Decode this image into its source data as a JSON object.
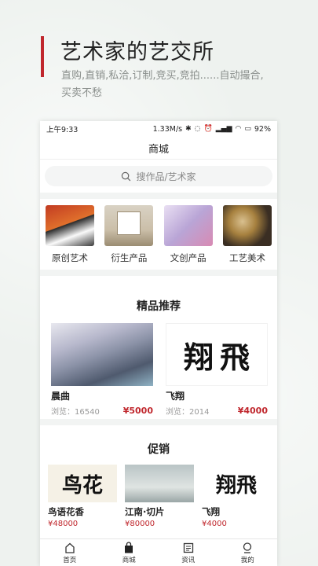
{
  "promo": {
    "title": "艺术家的艺交所",
    "subtitle": "直购,直销,私洽,订制,竞买,竞拍......自动撮合,买卖不愁"
  },
  "status": {
    "time": "上午9:33",
    "speed": "1.33M/s",
    "battery": "92%"
  },
  "header": {
    "title": "商城"
  },
  "search": {
    "placeholder": "搜作品/艺术家"
  },
  "categories": [
    {
      "label": "原创艺术"
    },
    {
      "label": "衍生产品"
    },
    {
      "label": "文创产品"
    },
    {
      "label": "工艺美术"
    }
  ],
  "featured": {
    "title": "精品推荐",
    "items": [
      {
        "name": "晨曲",
        "views": "浏览：16540",
        "price": "¥5000"
      },
      {
        "name": "飞翔",
        "views": "浏览：2014",
        "price": "¥4000"
      }
    ]
  },
  "promotion": {
    "title": "促销",
    "items": [
      {
        "name": "鸟语花香",
        "price": "¥48000"
      },
      {
        "name": "江南·切片",
        "price": "¥80000"
      },
      {
        "name": "飞翔",
        "price": "¥4000"
      }
    ]
  },
  "tabs": [
    {
      "label": "首页",
      "icon": "home-icon"
    },
    {
      "label": "商城",
      "icon": "bag-icon"
    },
    {
      "label": "资讯",
      "icon": "news-icon"
    },
    {
      "label": "我的",
      "icon": "user-icon"
    }
  ],
  "colors": {
    "accent": "#c0272d"
  }
}
